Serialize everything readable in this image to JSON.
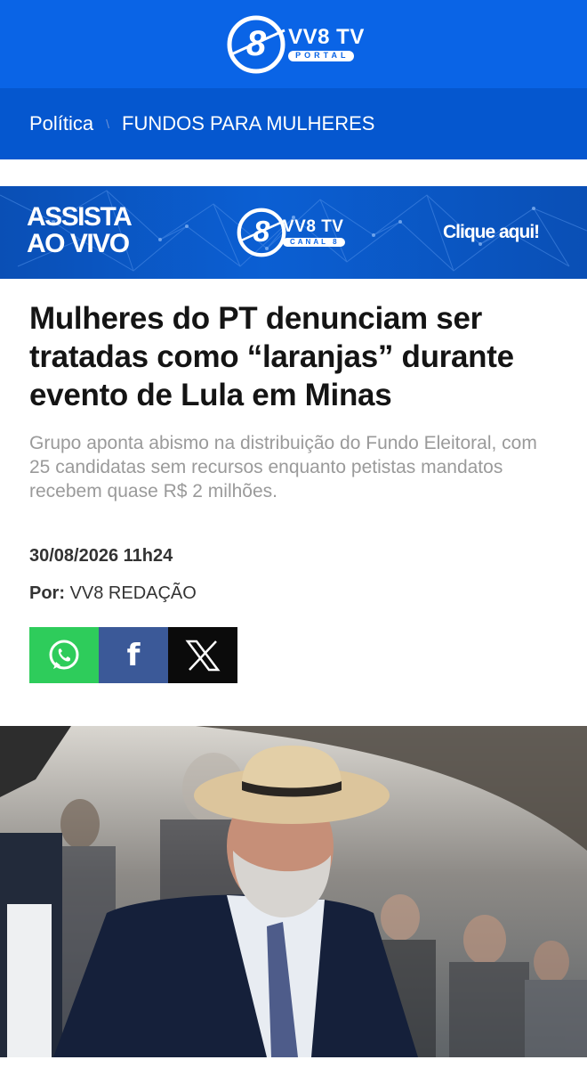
{
  "header": {
    "logo_title": "VV8 TV",
    "logo_sub": "PORTAL",
    "logo_icon": "vv8-logo-icon",
    "bg_color": "#0a64e6"
  },
  "breadcrumb": {
    "section": "Política",
    "separator": "\\",
    "current": "FUNDOS PARA MULHERES"
  },
  "banner": {
    "live_line1": "ASSISTA",
    "live_line2": "AO VIVO",
    "logo_title": "VV8 TV",
    "logo_sub": "CANAL 8",
    "cta": "Clique aqui!"
  },
  "article": {
    "headline": "Mulheres do PT denunciam ser tratadas como “laranjas” durante evento de Lula em Minas",
    "subheadline": "Grupo aponta abismo na distribuição do Fundo Eleitoral, com 25 candidatas sem recursos enquanto petistas mandatos recebem quase R$ 2 milhões.",
    "date": "30/08/2026 11h24",
    "author_label": "Por:",
    "author": "VV8 REDAÇÃO"
  },
  "share": {
    "whatsapp_icon": "whatsapp-icon",
    "facebook_icon": "facebook-icon",
    "facebook_glyph": "f",
    "x_icon": "x-icon",
    "colors": {
      "whatsapp": "#2ecc5b",
      "facebook": "#3b5998",
      "x": "#0b0b0b"
    }
  }
}
